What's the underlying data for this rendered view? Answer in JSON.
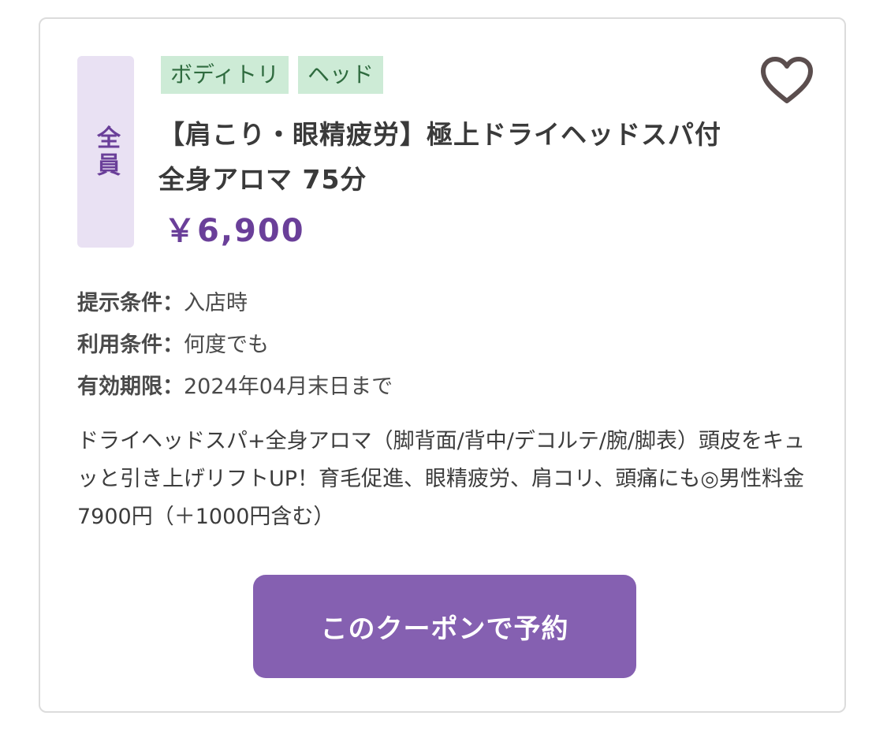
{
  "coupon": {
    "target_badge": "全員",
    "tags": [
      "ボディトリ",
      "ヘッド"
    ],
    "title": "【肩こり・眼精疲労】極上ドライヘッドスパ付全身アロマ 75分",
    "price": "￥6,900",
    "conditions": [
      {
        "label": "提示条件：",
        "value": "入店時"
      },
      {
        "label": "利用条件：",
        "value": "何度でも"
      },
      {
        "label": "有効期限：",
        "value": "2024年04月末日まで"
      }
    ],
    "description": "ドライヘッドスパ+全身アロマ（脚背面/背中/デコルテ/腕/脚表）頭皮をキュッと引き上げリフトUP！育毛促進、眼精疲労、肩コリ、頭痛にも◎男性料金7900円（＋1000円含む）",
    "reserve_button": "このクーポンで予約",
    "favorite_icon": "heart-outline-icon"
  },
  "colors": {
    "accent_purple": "#8560b1",
    "price_purple": "#6a3f99",
    "badge_bg": "#e9e1f3",
    "tag_bg": "#cdebd6",
    "tag_text": "#2f6b3f"
  }
}
